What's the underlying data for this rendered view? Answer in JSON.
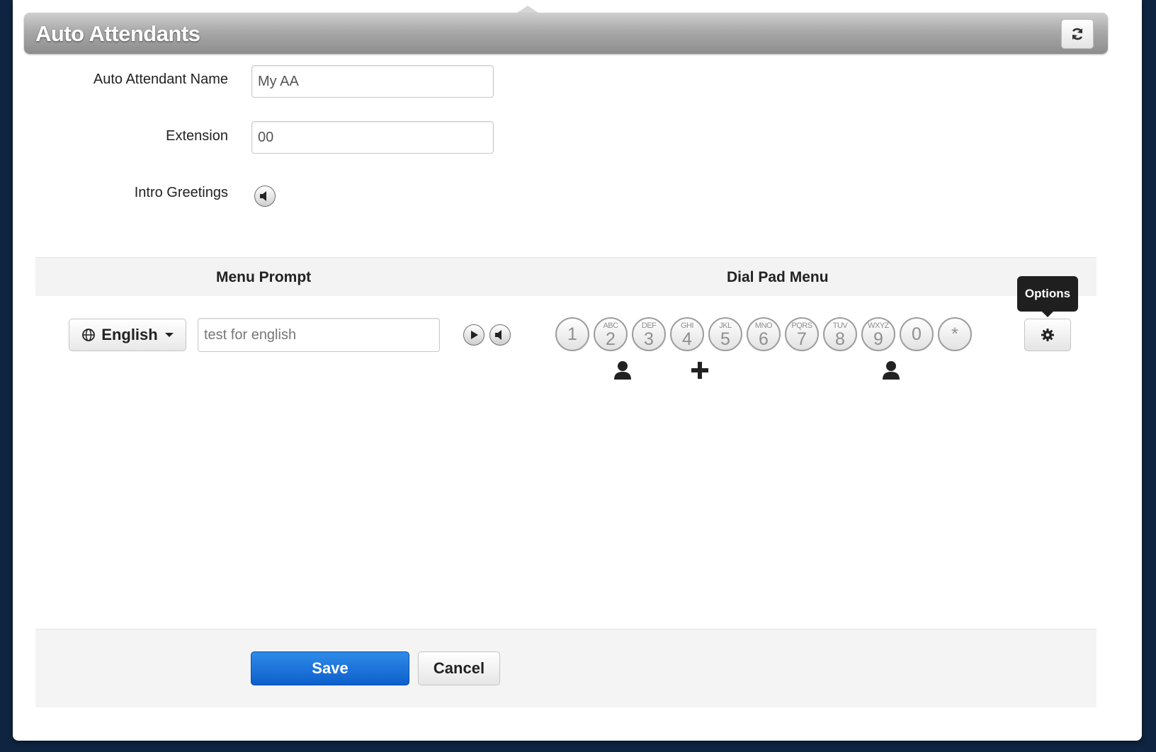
{
  "header": {
    "title": "Auto Attendants",
    "refresh_icon": "refresh-icon"
  },
  "form": {
    "name_label": "Auto Attendant Name",
    "name_value": "My AA",
    "extension_label": "Extension",
    "extension_value": "00",
    "intro_label": "Intro Greetings",
    "intro_icon": "speaker-icon"
  },
  "menu": {
    "prompt_heading": "Menu Prompt",
    "dialpad_heading": "Dial Pad Menu",
    "language_label": "English",
    "language_icon": "globe-icon",
    "prompt_value": "test for english",
    "play_icon": "play-icon",
    "speaker_icon": "speaker-icon",
    "keys": [
      {
        "num": "1",
        "letters": ""
      },
      {
        "num": "2",
        "letters": "ABC"
      },
      {
        "num": "3",
        "letters": "DEF"
      },
      {
        "num": "4",
        "letters": "GHI"
      },
      {
        "num": "5",
        "letters": "JKL"
      },
      {
        "num": "6",
        "letters": "MNO"
      },
      {
        "num": "7",
        "letters": "PQRS"
      },
      {
        "num": "8",
        "letters": "TUV"
      },
      {
        "num": "9",
        "letters": "WXYZ"
      },
      {
        "num": "0",
        "letters": ""
      },
      {
        "num": "*",
        "letters": ""
      }
    ],
    "key_assignments": [
      {
        "key": "2",
        "icon": "user-icon"
      },
      {
        "key": "4",
        "icon": "plus-icon"
      },
      {
        "key": "9",
        "icon": "user-icon"
      }
    ],
    "options_tooltip": "Options",
    "options_icon": "gear-icon"
  },
  "footer": {
    "save_label": "Save",
    "cancel_label": "Cancel"
  },
  "colors": {
    "save_button": "#1470d8",
    "header_bar": "#a3a3a3",
    "background": "#0f2440"
  }
}
